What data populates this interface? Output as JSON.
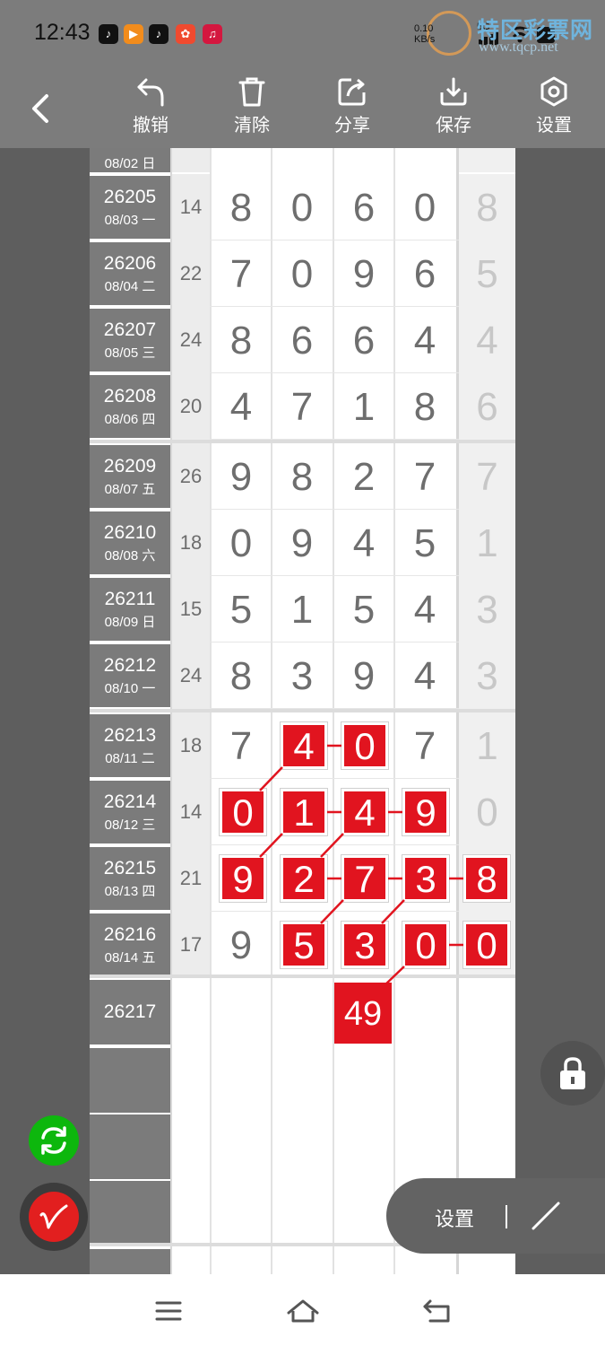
{
  "status": {
    "time": "12:43",
    "speed": "0.10",
    "speed_unit": "KB/s",
    "network": "5G"
  },
  "watermark": {
    "title": "特区彩票网",
    "url": "www.tqcp.net"
  },
  "toolbar": {
    "undo": "撤销",
    "clear": "清除",
    "share": "分享",
    "save": "保存",
    "settings": "设置"
  },
  "table": {
    "top_partial": {
      "date": "08/02 日"
    },
    "rows": [
      {
        "issue": "26205",
        "date": "08/03 一",
        "sum": "14",
        "d1": "8",
        "d2": "0",
        "d3": "6",
        "d4": "0",
        "d5": "8"
      },
      {
        "issue": "26206",
        "date": "08/04 二",
        "sum": "22",
        "d1": "7",
        "d2": "0",
        "d3": "9",
        "d4": "6",
        "d5": "5"
      },
      {
        "issue": "26207",
        "date": "08/05 三",
        "sum": "24",
        "d1": "8",
        "d2": "6",
        "d3": "6",
        "d4": "4",
        "d5": "4"
      },
      {
        "issue": "26208",
        "date": "08/06 四",
        "sum": "20",
        "d1": "4",
        "d2": "7",
        "d3": "1",
        "d4": "8",
        "d5": "6"
      },
      {
        "issue": "26209",
        "date": "08/07 五",
        "sum": "26",
        "d1": "9",
        "d2": "8",
        "d3": "2",
        "d4": "7",
        "d5": "7"
      },
      {
        "issue": "26210",
        "date": "08/08 六",
        "sum": "18",
        "d1": "0",
        "d2": "9",
        "d3": "4",
        "d4": "5",
        "d5": "1"
      },
      {
        "issue": "26211",
        "date": "08/09 日",
        "sum": "15",
        "d1": "5",
        "d2": "1",
        "d3": "5",
        "d4": "4",
        "d5": "3"
      },
      {
        "issue": "26212",
        "date": "08/10 一",
        "sum": "24",
        "d1": "8",
        "d2": "3",
        "d3": "9",
        "d4": "4",
        "d5": "3"
      },
      {
        "issue": "26213",
        "date": "08/11 二",
        "sum": "18",
        "d1": "7",
        "d2": "4",
        "d3": "0",
        "d4": "7",
        "d5": "1"
      },
      {
        "issue": "26214",
        "date": "08/12 三",
        "sum": "14",
        "d1": "0",
        "d2": "1",
        "d3": "4",
        "d4": "9",
        "d5": "0"
      },
      {
        "issue": "26215",
        "date": "08/13 四",
        "sum": "21",
        "d1": "9",
        "d2": "2",
        "d3": "7",
        "d4": "3",
        "d5": "8"
      },
      {
        "issue": "26216",
        "date": "08/14 五",
        "sum": "17",
        "d1": "9",
        "d2": "5",
        "d3": "3",
        "d4": "0",
        "d5": "0"
      }
    ],
    "next_issue": "26217",
    "prediction": "49"
  },
  "float_menu": {
    "settings_label": "设置"
  },
  "colors": {
    "highlight": "#e1141f",
    "toolbar": "#7c7c7c",
    "green": "#0db70d"
  }
}
